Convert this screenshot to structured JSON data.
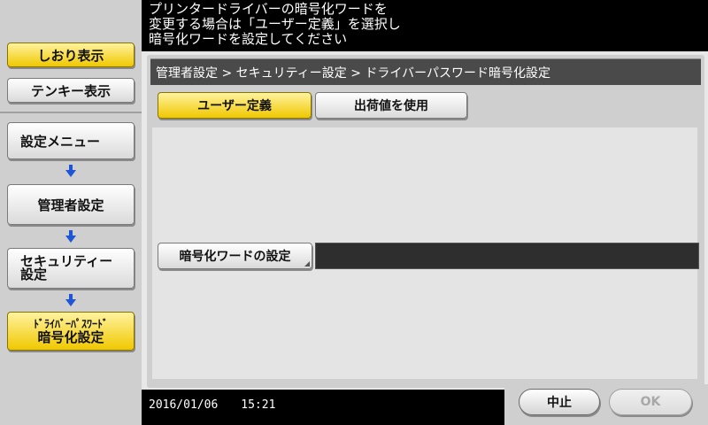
{
  "message": "プリンタードライバーの暗号化ワードを\n変更する場合は「ユーザー定義」を選択し\n暗号化ワードを設定してください",
  "sidebar": {
    "bookmark_label": "しおり表示",
    "keypad_label": "テンキー表示",
    "nav": {
      "settings_menu": "設定メニュー",
      "admin_settings": "管理者設定",
      "security_line1": "セキュリティー",
      "security_line2": "設定",
      "driver_line1": "ﾄﾞﾗｲﾊﾞｰﾊﾟｽﾜｰﾄﾞ",
      "driver_line2": "暗号化設定"
    }
  },
  "breadcrumb": "管理者設定 > セキュリティー設定 > ドライバーパスワード暗号化設定",
  "tabs": {
    "user_defined": "ユーザー定義",
    "factory_default": "出荷値を使用"
  },
  "password_setting": {
    "button_label": "暗号化ワードの設定",
    "value": ""
  },
  "footer": {
    "date": "2016/01/06",
    "time": "15:21",
    "cancel_label": "中止",
    "ok_label": "OK"
  },
  "colors": {
    "accent_active": "#f0c800",
    "background": "#000000",
    "panel": "#cfcfcf"
  }
}
